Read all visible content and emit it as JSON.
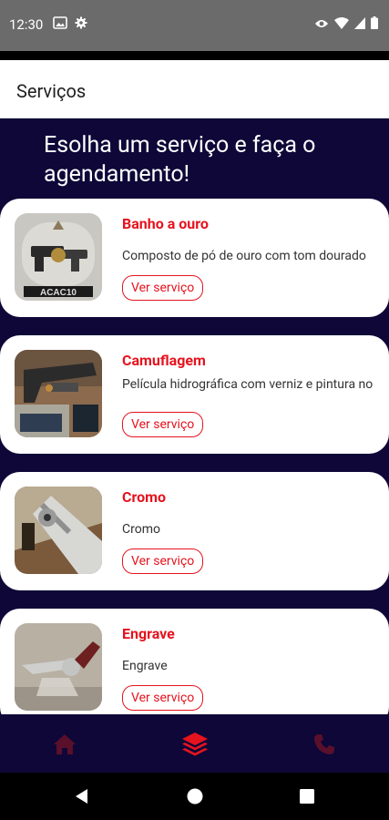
{
  "status": {
    "time": "12:30"
  },
  "header": {
    "title": "Serviços"
  },
  "main": {
    "heading": "Esolha um serviço e faça o agendamento!",
    "services": [
      {
        "title": "Banho a ouro",
        "description": "Composto de pó de ouro com tom dourado",
        "button": "Ver serviço"
      },
      {
        "title": "Camuflagem",
        "description": "Película hidrográfica com verniz e pintura no",
        "button": "Ver serviço"
      },
      {
        "title": "Cromo",
        "description": "Cromo",
        "button": "Ver serviço"
      },
      {
        "title": "Engrave",
        "description": "Engrave",
        "button": "Ver serviço"
      }
    ]
  },
  "nav": {
    "items": [
      {
        "icon": "home-icon",
        "active": false
      },
      {
        "icon": "layers-icon",
        "active": true
      },
      {
        "icon": "phone-icon",
        "active": false
      }
    ]
  },
  "colors": {
    "accent": "#e5131e",
    "background": "#0e0738",
    "inactive_nav": "#5a0f2b"
  }
}
